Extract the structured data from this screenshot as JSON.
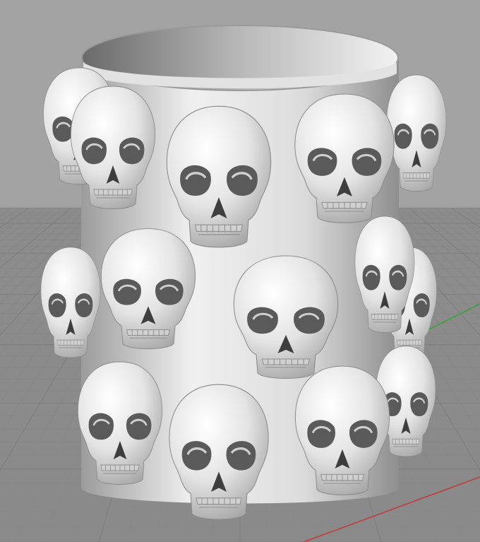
{
  "viewport": {
    "view_type": "perspective",
    "background_color": "#a3a3a3",
    "grid_color": "#7c7c7c",
    "grid_minor_color": "#888888",
    "axis_x_color": "#c23a3a",
    "axis_y_color": "#3aa03a"
  },
  "model": {
    "shape": "cylindrical cup covered with skulls",
    "shading": "clay",
    "material_color": "#e4e4e4"
  }
}
